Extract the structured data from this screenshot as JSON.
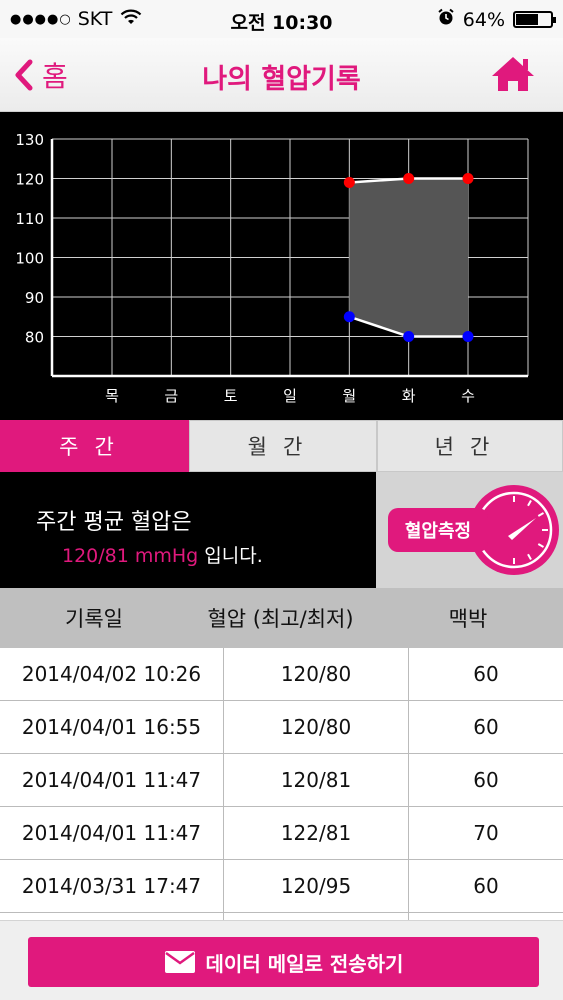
{
  "status_bar": {
    "signal": "●●●●○",
    "carrier": "SKT",
    "time": "오전 10:30",
    "battery": "64%",
    "battery_level": 0.64,
    "icons": [
      "wifi-icon",
      "alarm-icon",
      "battery-icon"
    ]
  },
  "nav": {
    "back_label": "홈",
    "title": "나의 혈압기록",
    "home_icon": "home-icon"
  },
  "colors": {
    "accent": "#e0197d",
    "systolic": "#ff0000",
    "diastolic": "#0000ff",
    "band": "#555555"
  },
  "chart_data": {
    "type": "line",
    "categories": [
      "목",
      "금",
      "토",
      "일",
      "월",
      "화",
      "수"
    ],
    "series": [
      {
        "values": [
          null,
          null,
          null,
          null,
          119,
          120,
          120
        ]
      },
      {
        "values": [
          null,
          null,
          null,
          null,
          85,
          80,
          80
        ]
      }
    ],
    "ylim": [
      70,
      130
    ],
    "yticks": [
      80,
      90,
      100,
      110,
      120,
      130
    ],
    "grid": true
  },
  "tabs": [
    {
      "label": "주간",
      "active": true
    },
    {
      "label": "월간",
      "active": false
    },
    {
      "label": "년간",
      "active": false
    }
  ],
  "average": {
    "line1": "주간 평균 혈압은",
    "value": "120/81 mmHg",
    "suffix": " 입니다."
  },
  "measure_button": "혈압측정",
  "table": {
    "headers": [
      "기록일",
      "혈압 (최고/최저)",
      "맥박"
    ],
    "rows": [
      [
        "2014/04/02 10:26",
        "120/80",
        "60"
      ],
      [
        "2014/04/01 16:55",
        "120/80",
        "60"
      ],
      [
        "2014/04/01 11:47",
        "120/81",
        "60"
      ],
      [
        "2014/04/01 11:47",
        "122/81",
        "70"
      ],
      [
        "2014/03/31 17:47",
        "120/95",
        "60"
      ]
    ]
  },
  "send_button": "데이터 메일로 전송하기"
}
